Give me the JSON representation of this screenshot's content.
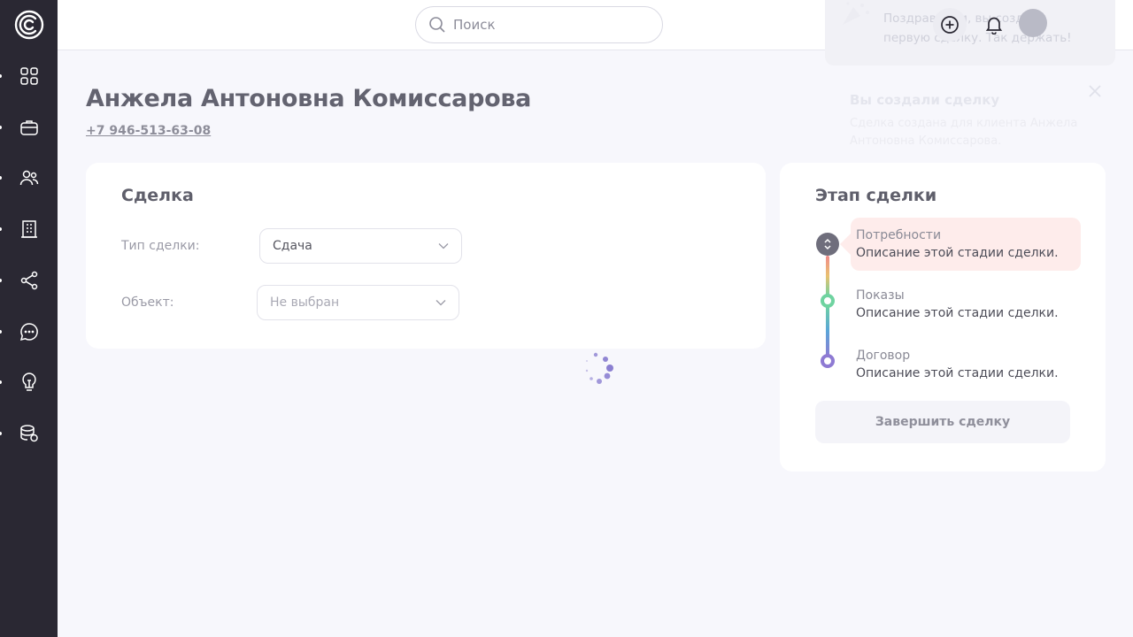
{
  "header": {
    "search_placeholder": "Поиск",
    "toast_text": "Поздравляем, вы создали первую сделку. Так держать!"
  },
  "notification": {
    "title": "Вы создали сделку",
    "text": "Сделка создана для клиента Анжела Антоновна Комиссарова."
  },
  "client": {
    "name": "Анжела Антоновна Комиссарова",
    "phone": "+7 946-513-63-08"
  },
  "deal": {
    "title": "Сделка",
    "type_label": "Тип сделки:",
    "type_value": "Сдача",
    "object_label": "Объект:",
    "object_value": "Не выбран"
  },
  "stages": {
    "title": "Этап сделки",
    "items": [
      {
        "name": "Потребности",
        "description": "Описание этой стадии сделки."
      },
      {
        "name": "Показы",
        "description": "Описание этой стадии сделки."
      },
      {
        "name": "Договор",
        "description": "Описание этой стадии сделки."
      }
    ],
    "finish_label": "Завершить сделку"
  },
  "icons": {
    "nav": [
      "dashboard-icon",
      "briefcase-icon",
      "users-icon",
      "building-icon",
      "share-icon",
      "chat-icon",
      "lightbulb-icon",
      "database-icon"
    ]
  },
  "colors": {
    "sidebar": "#2a2833",
    "accent": "#8b7fd1",
    "stage_highlight": "#feeceb"
  }
}
